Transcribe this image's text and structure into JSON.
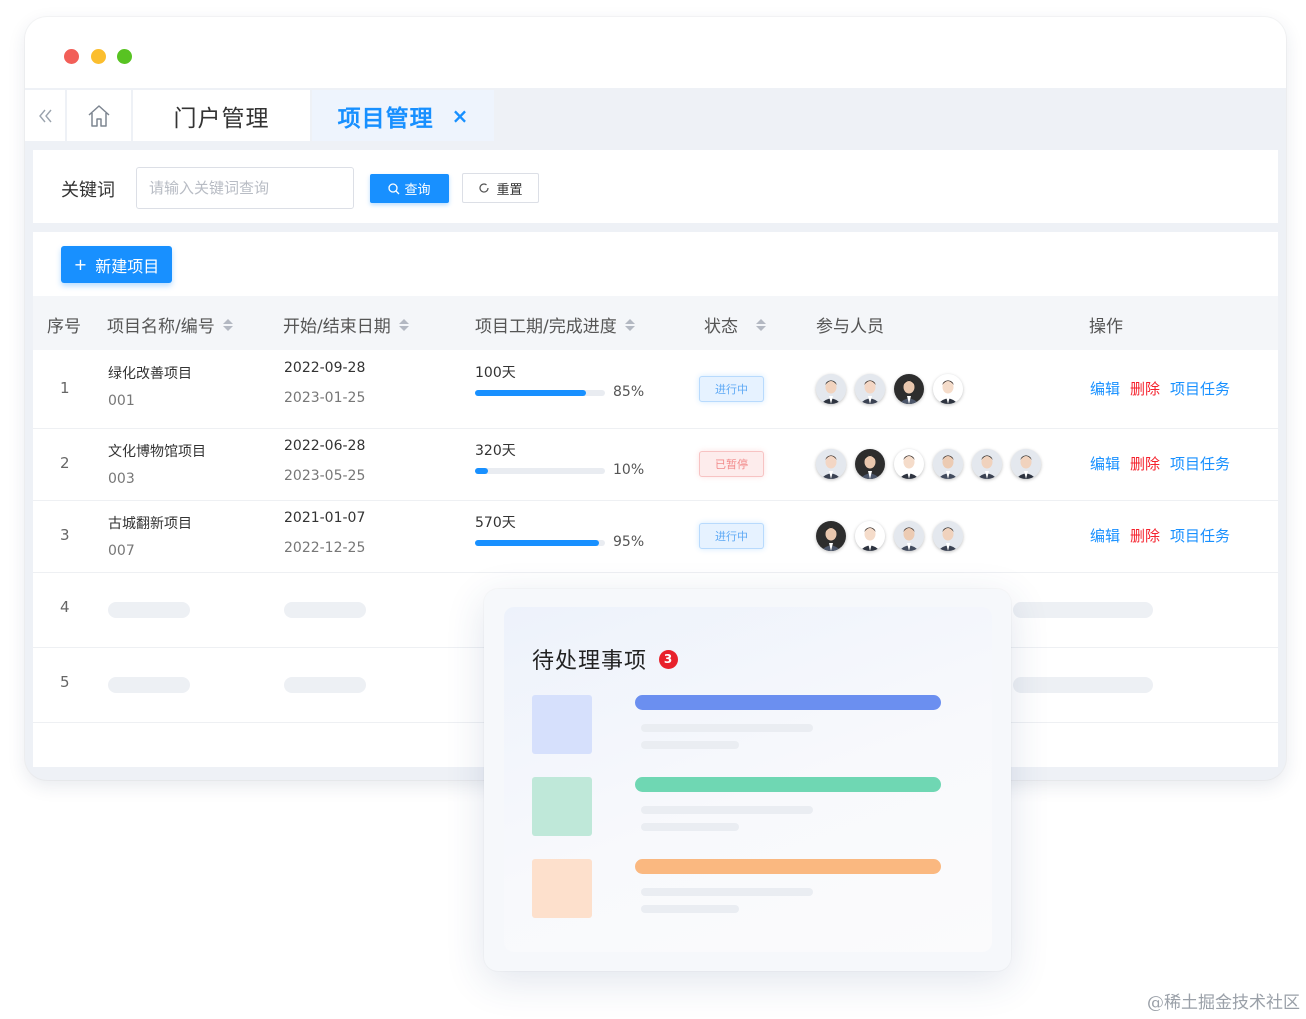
{
  "window": {
    "tabs": [
      {
        "label": "门户管理"
      },
      {
        "label": "项目管理",
        "close": "×",
        "active": true
      }
    ],
    "collapse_icon": "double-chevron-left-icon",
    "home_icon": "home-icon"
  },
  "search": {
    "label": "关键词",
    "placeholder": "请输入关键词查询",
    "value": "",
    "query_label": "查询",
    "reset_label": "重置"
  },
  "toolbar": {
    "new_label": "新建项目",
    "new_icon": "+"
  },
  "table": {
    "columns": [
      "序号",
      "项目名称/编号",
      "开始/结束日期",
      "项目工期/完成进度",
      "状态",
      "参与人员",
      "操作"
    ],
    "rows": [
      {
        "index": "1",
        "name": "绿化改善项目",
        "code": "001",
        "start": "2022-09-28",
        "end": "2023-01-25",
        "duration": "100天",
        "progress": 85,
        "progress_label": "85%",
        "status": "进行中",
        "status_type": "running",
        "members": 4
      },
      {
        "index": "2",
        "name": "文化博物馆项目",
        "code": "003",
        "start": "2022-06-28",
        "end": "2023-05-25",
        "duration": "320天",
        "progress": 10,
        "progress_label": "10%",
        "status": "已暂停",
        "status_type": "paused",
        "members": 6
      },
      {
        "index": "3",
        "name": "古城翻新项目",
        "code": "007",
        "start": "2021-01-07",
        "end": "2022-12-25",
        "duration": "570天",
        "progress": 95,
        "progress_label": "95%",
        "status": "进行中",
        "status_type": "running",
        "members": 4
      },
      {
        "index": "4"
      },
      {
        "index": "5"
      }
    ],
    "actions": {
      "edit": "编辑",
      "delete": "删除",
      "tasks": "项目任务"
    }
  },
  "popup": {
    "title": "待处理事项",
    "badge": "3",
    "items": [
      {
        "thumb_color": "#d6e0fc",
        "bar_color": "#6b8ff0"
      },
      {
        "thumb_color": "#bfe8d9",
        "bar_color": "#6fd7b3"
      },
      {
        "thumb_color": "#fde0cc",
        "bar_color": "#fab880"
      }
    ]
  },
  "colors": {
    "accent": "#1890ff",
    "danger": "#f5222d"
  },
  "watermark": "@稀土掘金技术社区"
}
